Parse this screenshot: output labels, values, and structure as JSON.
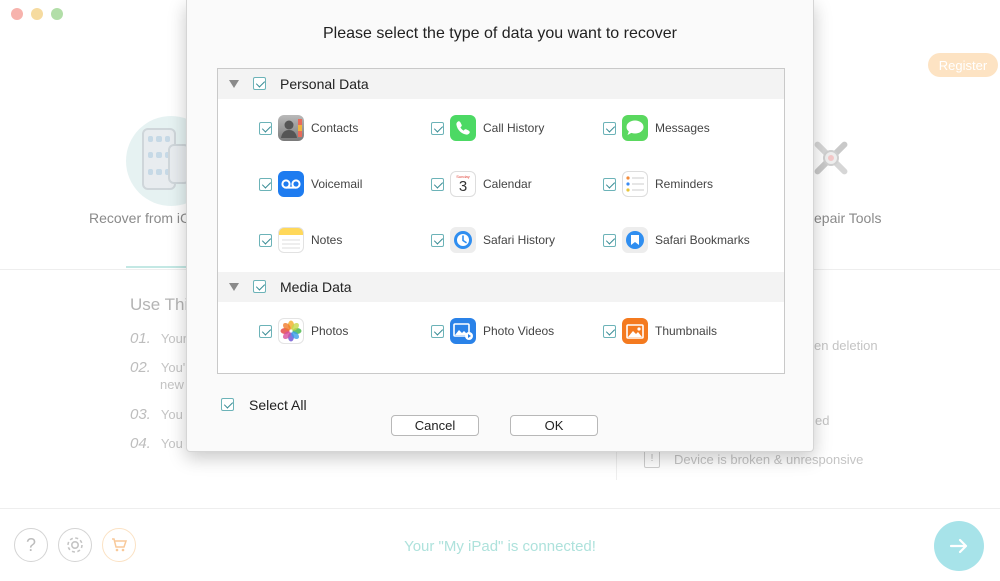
{
  "window": {
    "register_label": "Register"
  },
  "background": {
    "card_icloud_label": "Recover from iC",
    "card_repair_label": "epair Tools",
    "use_title": "Use Thi",
    "steps": [
      {
        "num": "01.",
        "text": "Your"
      },
      {
        "num": "02.",
        "text": "You'",
        "text2": "new"
      },
      {
        "num": "03.",
        "text": "You c"
      },
      {
        "num": "04.",
        "text": "You c"
      }
    ],
    "right_items": [
      "en deletion",
      "ed",
      "Device is broken & unresponsive"
    ],
    "status": "Your \"My iPad\" is connected!"
  },
  "modal": {
    "title": "Please select the type of data you want to recover",
    "sections": [
      {
        "label": "Personal Data",
        "items": [
          {
            "label": "Contacts",
            "icon": "contacts-icon"
          },
          {
            "label": "Call History",
            "icon": "phone-icon"
          },
          {
            "label": "Messages",
            "icon": "message-bubble-icon"
          },
          {
            "label": "Voicemail",
            "icon": "voicemail-icon"
          },
          {
            "label": "Calendar",
            "icon": "calendar-icon",
            "day_name": "Sunday",
            "day_num": "3"
          },
          {
            "label": "Reminders",
            "icon": "reminders-icon"
          },
          {
            "label": "Notes",
            "icon": "notes-icon"
          },
          {
            "label": "Safari History",
            "icon": "safari-history-icon"
          },
          {
            "label": "Safari Bookmarks",
            "icon": "safari-bookmarks-icon"
          }
        ]
      },
      {
        "label": "Media Data",
        "items": [
          {
            "label": "Photos",
            "icon": "photos-icon"
          },
          {
            "label": "Photo Videos",
            "icon": "photo-videos-icon"
          },
          {
            "label": "Thumbnails",
            "icon": "thumbnails-icon"
          }
        ]
      }
    ],
    "select_all_label": "Select All",
    "cancel_label": "Cancel",
    "ok_label": "OK"
  },
  "colors": {
    "accent_teal": "#3a8d96",
    "checkbox_border": "#6cb3b8",
    "status_text": "#aee2dc",
    "next_button": "#a7e3e9",
    "register_button": "#fde3c3"
  }
}
